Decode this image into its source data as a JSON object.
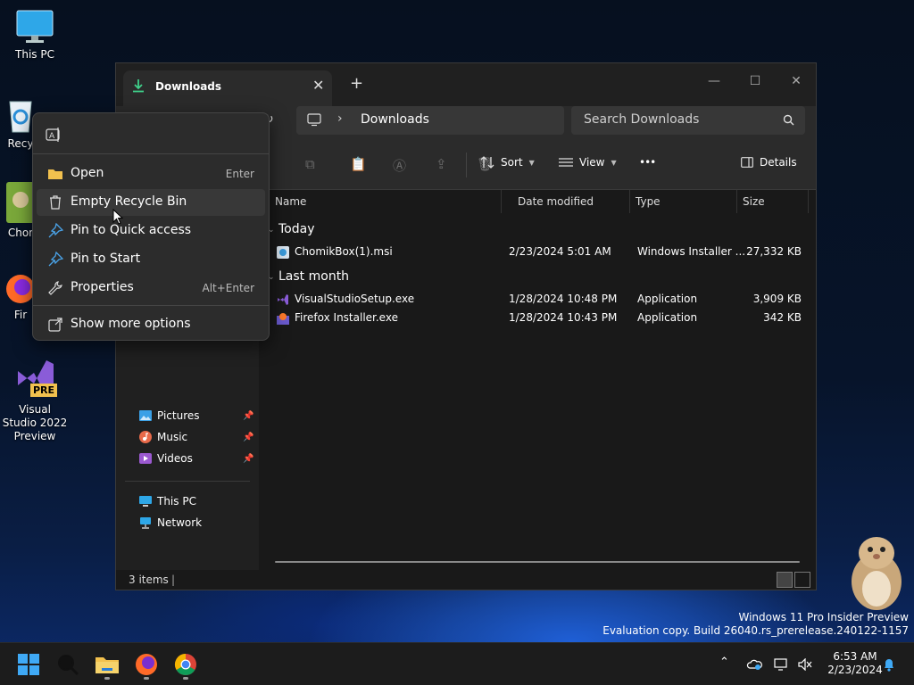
{
  "desktop": {
    "icons": [
      {
        "label": "This PC"
      },
      {
        "label": "Recy"
      },
      {
        "label": "Chor"
      },
      {
        "label": "Fir"
      },
      {
        "label": "Visual Studio 2022 Preview",
        "badge": "PRE"
      }
    ]
  },
  "window": {
    "tab_title": "Downloads",
    "tab_close": "✕",
    "tab_add": "+",
    "controls": {
      "minimize": "—",
      "maximize": "☐",
      "close": "✕"
    },
    "breadcrumb": {
      "separator": "›",
      "current": "Downloads"
    },
    "search_placeholder": "Search Downloads",
    "toolbar": {
      "sort": "Sort",
      "view": "View",
      "more": "•••",
      "details": "Details"
    },
    "sidebar": [
      {
        "label": "Pictures",
        "pinned": true
      },
      {
        "label": "Music",
        "pinned": true
      },
      {
        "label": "Videos",
        "pinned": true
      },
      {
        "label": "This PC",
        "pinned": false
      },
      {
        "label": "Network",
        "pinned": false
      }
    ],
    "columns": [
      "Name",
      "Date modified",
      "Type",
      "Size"
    ],
    "groups": [
      {
        "label": "Today",
        "files": [
          {
            "name": "ChomikBox(1).msi",
            "date": "2/23/2024 5:01 AM",
            "type": "Windows Installer ...",
            "size": "27,332 KB"
          }
        ]
      },
      {
        "label": "Last month",
        "files": [
          {
            "name": "VisualStudioSetup.exe",
            "date": "1/28/2024 10:48 PM",
            "type": "Application",
            "size": "3,909 KB"
          },
          {
            "name": "Firefox Installer.exe",
            "date": "1/28/2024 10:43 PM",
            "type": "Application",
            "size": "342 KB"
          }
        ]
      }
    ],
    "status": "3 items"
  },
  "context_menu": {
    "items": [
      {
        "label": "Open",
        "shortcut": "Enter",
        "icon": "folder-icon"
      },
      {
        "label": "Empty Recycle Bin",
        "shortcut": "",
        "icon": "trash-icon"
      },
      {
        "label": "Pin to Quick access",
        "shortcut": "",
        "icon": "pin-icon"
      },
      {
        "label": "Pin to Start",
        "shortcut": "",
        "icon": "pin-icon"
      },
      {
        "label": "Properties",
        "shortcut": "Alt+Enter",
        "icon": "wrench-icon"
      },
      {
        "label": "Show more options",
        "shortcut": "",
        "icon": "share-icon"
      }
    ]
  },
  "watermark": {
    "line1": "Windows 11 Pro Insider Preview",
    "line2": "Evaluation copy. Build 26040.rs_prerelease.240122-1157"
  },
  "clock": {
    "time": "6:53 AM",
    "date": "2/23/2024"
  },
  "colors": {
    "accent": "#0078d4",
    "folder": "#f2c14e",
    "menu_bg": "#2c2c2c"
  }
}
